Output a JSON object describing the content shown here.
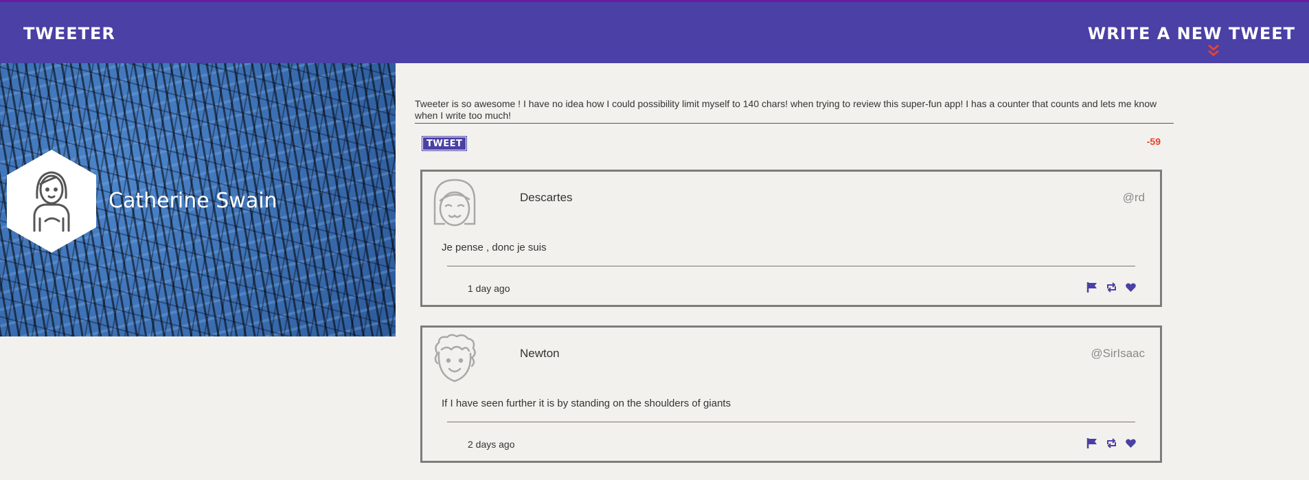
{
  "nav": {
    "brand": "TWEETER",
    "compose_label": "WRITE A NEW TWEET",
    "compose_icon": "double-chevron-down-icon",
    "accent": "#e8412a",
    "bar_color": "#4a40a5"
  },
  "profile": {
    "username": "Catherine Swain",
    "avatar_icon": "girl-avatar-icon"
  },
  "compose": {
    "text": "Tweeter is so awesome ! I have no idea how I could possibility limit myself to 140 chars! when trying to review this super-fun app! I has a counter that counts and lets me know when I write too much!",
    "button_label": "TWEET",
    "counter": "-59"
  },
  "tweets": [
    {
      "name": "Descartes",
      "handle": "@rd",
      "body": "Je pense , donc je suis",
      "time": "1 day ago",
      "avatar_icon": "girl-face-icon"
    },
    {
      "name": "Newton",
      "handle": "@SirIsaac",
      "body": "If I have seen further it is by standing on the shoulders of giants",
      "time": "2 days ago",
      "avatar_icon": "curly-hair-face-icon"
    }
  ]
}
